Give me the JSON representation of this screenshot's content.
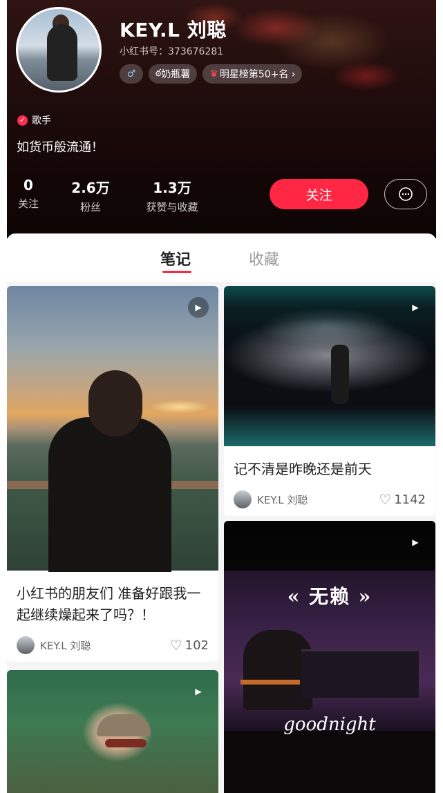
{
  "profile": {
    "name": "KEY.L 刘聪",
    "id_text": "小红书号：373676281",
    "tags": [
      "♂",
      "奶瓶薯",
      "明星榜第50+名 ›"
    ],
    "verified_label": "歌手",
    "bio": "如货币般流通！",
    "stats": [
      {
        "value": "0",
        "label": "关注"
      },
      {
        "value": "2.6万",
        "label": "粉丝"
      },
      {
        "value": "1.3万",
        "label": "获赞与收藏"
      }
    ],
    "follow_label": "关注",
    "message_icon": "chat-bubble-icon"
  },
  "tabs": [
    {
      "label": "笔记",
      "active": true
    },
    {
      "label": "收藏",
      "active": false
    }
  ],
  "notes": [
    {
      "title": "小红书的朋友们 准备好跟我一起继续燥起来了吗？！",
      "author": "KEY.L 刘聪",
      "likes": "102",
      "is_video": true
    },
    {
      "title": "记不清是昨晚还是前天",
      "author": "KEY.L 刘聪",
      "likes": "1142",
      "is_video": true
    },
    {
      "title": "",
      "author": "",
      "likes": "",
      "is_video": true,
      "overlay_title": "« 无赖 »",
      "overlay_subtitle": "goodnight"
    },
    {
      "title": "",
      "author": "",
      "likes": "",
      "is_video": true
    }
  ],
  "colors": {
    "accent": "#ff2744",
    "header_bg": "#1a0a0a",
    "text_primary": "#222222",
    "text_secondary": "#999999"
  }
}
